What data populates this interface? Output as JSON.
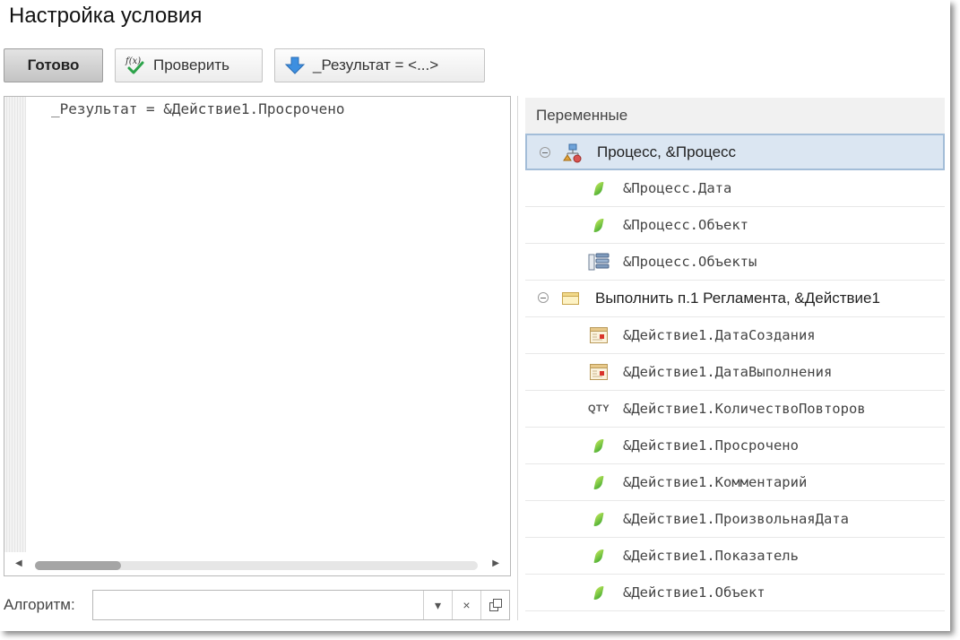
{
  "title": "Настройка условия",
  "toolbar": {
    "done_label": "Готово",
    "check_label": "Проверить",
    "check_icon": "formula-check-icon",
    "result_label": "_Результат = <...>",
    "result_icon": "arrow-down-icon"
  },
  "editor": {
    "code": "_Результат = &Действие1.Просрочено"
  },
  "algorithm": {
    "label": "Алгоритм:",
    "value": "",
    "dropdown_icon": "▾",
    "clear_icon": "×",
    "open_icon": "open-window-icon"
  },
  "variables": {
    "header": "Переменные",
    "groups": [
      {
        "label": "Процесс, &Процесс",
        "icon": "process-icon",
        "selected": true,
        "items": [
          {
            "label": "&Процесс.Дата",
            "icon": "attribute-icon"
          },
          {
            "label": "&Процесс.Объект",
            "icon": "attribute-icon"
          },
          {
            "label": "&Процесс.Объекты",
            "icon": "table-icon"
          }
        ]
      },
      {
        "label": "Выполнить п.1 Регламента, &Действие1",
        "icon": "action-icon",
        "selected": false,
        "items": [
          {
            "label": "&Действие1.ДатаСоздания",
            "icon": "calendar-icon"
          },
          {
            "label": "&Действие1.ДатаВыполнения",
            "icon": "calendar-icon"
          },
          {
            "label": "&Действие1.КоличествоПовторов",
            "icon": "qty-icon",
            "icon_text": "QTY"
          },
          {
            "label": "&Действие1.Просрочено",
            "icon": "attribute-icon"
          },
          {
            "label": "&Действие1.Комментарий",
            "icon": "attribute-icon"
          },
          {
            "label": "&Действие1.ПроизвольнаяДата",
            "icon": "attribute-icon"
          },
          {
            "label": "&Действие1.Показатель",
            "icon": "attribute-icon"
          },
          {
            "label": "&Действие1.Объект",
            "icon": "attribute-icon"
          }
        ]
      }
    ]
  }
}
